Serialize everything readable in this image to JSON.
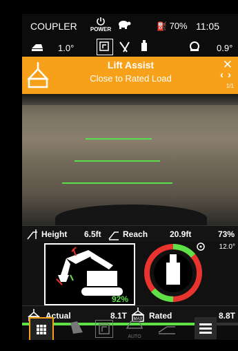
{
  "status": {
    "coupler": "COUPLER",
    "power": "POWER",
    "fuel": "70%",
    "time": "11:05"
  },
  "tilt": {
    "pitch": "1.0°",
    "roll": "0.9°"
  },
  "banner": {
    "title": "Lift Assist",
    "subtitle": "Close to Rated Load",
    "page": "1/1",
    "color": "#f7a019"
  },
  "measurements": {
    "height_label": "Height",
    "height_value": "6.5ft",
    "reach_label": "Reach",
    "reach_value": "20.9ft",
    "percent": "73%"
  },
  "gauge": {
    "angle": "12.0°",
    "load_percent": "92%"
  },
  "load": {
    "actual_label": "Actual",
    "actual_value": "8.1T",
    "rated_label": "Rated",
    "rated_value": "8.8T",
    "rated_icon_text": "MAX"
  },
  "nav": {
    "auto_label": "AUTO"
  }
}
